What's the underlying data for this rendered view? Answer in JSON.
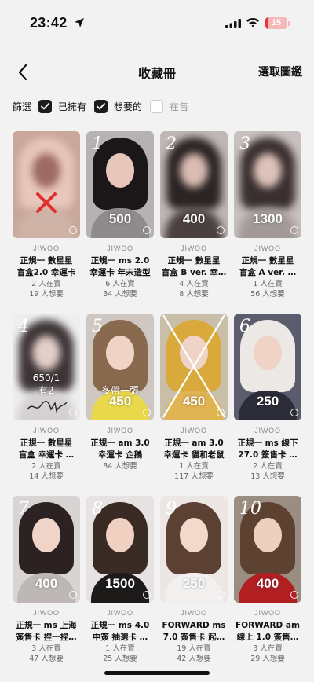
{
  "status": {
    "time": "23:42",
    "battery": "15",
    "battery_level": 0.15,
    "battery_color": "#e8353b"
  },
  "nav": {
    "title": "收藏冊",
    "right_action": "選取圖鑑"
  },
  "filters": {
    "label": "篩選",
    "items": [
      {
        "label": "已擁有",
        "checked": true
      },
      {
        "label": "想要的",
        "checked": true
      },
      {
        "label": "在售",
        "checked": false
      }
    ]
  },
  "cards": [
    {
      "brand": "JIWOO",
      "name1": "正規一 數星星",
      "name2": "盲盒2.0 幸運卡",
      "stat1": "2 人在賣",
      "stat2": "19 人想要",
      "price": "",
      "handwritten": "",
      "note1": "",
      "note2": "",
      "crossed": true,
      "blur": true,
      "colors": [
        "#c9a79a",
        "#e9c7bb",
        "#9c6a62",
        "#cfb3a7"
      ]
    },
    {
      "brand": "JIWOO",
      "name1": "正規一 ms 2.0",
      "name2": "幸運卡 年末造型",
      "stat1": "6 人在賣",
      "stat2": "34 人想要",
      "price": "500",
      "handwritten": "1",
      "note1": "",
      "note2": "",
      "crossed": false,
      "blur": false,
      "colors": [
        "#b6b1b2",
        "#1b1719",
        "#e7c7bb",
        "#8f8a8c"
      ]
    },
    {
      "brand": "JIWOO",
      "name1": "正規一 數星星",
      "name2": "盲盒 B ver. 幸…",
      "stat1": "4 人在賣",
      "stat2": "8 人想要",
      "price": "400",
      "handwritten": "2",
      "note1": "",
      "note2": "",
      "crossed": false,
      "blur": true,
      "colors": [
        "#bfb7b5",
        "#2b2424",
        "#d9bcb2",
        "#4a4040"
      ]
    },
    {
      "brand": "JIWOO",
      "name1": "正規一 數星星",
      "name2": "盲盒 A ver. …",
      "stat1": "1 人在賣",
      "stat2": "56 人想要",
      "price": "1300",
      "handwritten": "3",
      "note1": "",
      "note2": "",
      "crossed": false,
      "blur": true,
      "colors": [
        "#c8c0be",
        "#3a3030",
        "#dec3ba",
        "#a29997"
      ]
    },
    {
      "brand": "JIWOO",
      "name1": "正規一 數星星",
      "name2": "盲盒 幸運卡 …",
      "stat1": "2 人在賣",
      "stat2": "14 人想要",
      "price": "",
      "handwritten": "4",
      "note1": "650/1",
      "note2": "有2",
      "crossed": false,
      "blur": true,
      "colors": [
        "#eeeeee",
        "#3d3436",
        "#e2cfc9",
        "#d5d0d1"
      ]
    },
    {
      "brand": "JIWOO",
      "name1": "正規一 am 3.0",
      "name2": "幸運卡 企鵝",
      "stat1": "84 人想要",
      "stat2": "",
      "price": "450",
      "handwritten": "5",
      "note1": "",
      "note2": "多帶一張",
      "crossed": false,
      "blur": false,
      "colors": [
        "#cfc8c2",
        "#8a6a4e",
        "#efd3c6",
        "#e9d84a"
      ]
    },
    {
      "brand": "JIWOO",
      "name1": "正規一 am 3.0",
      "name2": "幸運卡 貓和老鼠",
      "stat1": "1 人在賣",
      "stat2": "117 人想要",
      "price": "450",
      "handwritten": "",
      "note1": "",
      "note2": "",
      "crossed": true,
      "blur": false,
      "colors": [
        "#c9bfa9",
        "#d9a93b",
        "#efd3c6",
        "#e1b452"
      ]
    },
    {
      "brand": "JIWOO",
      "name1": "正規一 ms 線下",
      "name2": "27.0 簽售卡 …",
      "stat1": "2 人在賣",
      "stat2": "13 人想要",
      "price": "250",
      "handwritten": "6",
      "note1": "",
      "note2": "",
      "crossed": false,
      "blur": false,
      "colors": [
        "#5b5d6e",
        "#ece8e6",
        "#efd3c6",
        "#2b2c38"
      ]
    },
    {
      "brand": "JIWOO",
      "name1": "正規一 ms 上海",
      "name2": "簽售卡 捏一捏…",
      "stat1": "3 人在賣",
      "stat2": "47 人想要",
      "price": "400",
      "handwritten": "7",
      "note1": "",
      "note2": "",
      "crossed": false,
      "blur": false,
      "colors": [
        "#d8d4d3",
        "#2c2223",
        "#f0d4c8",
        "#bdb7b6"
      ]
    },
    {
      "brand": "JIWOO",
      "name1": "正規一 ms 4.0",
      "name2": "中簽 抽選卡 …",
      "stat1": "1 人在賣",
      "stat2": "25 人想要",
      "price": "1500",
      "handwritten": "8",
      "note1": "",
      "note2": "",
      "crossed": false,
      "blur": false,
      "colors": [
        "#e6e2e1",
        "#3a2a24",
        "#efd0c1",
        "#1d1a1a"
      ]
    },
    {
      "brand": "JIWOO",
      "name1": "FORWARD ms",
      "name2": "7.0 簽售卡 起…",
      "stat1": "19 人在賣",
      "stat2": "42 人想要",
      "price": "250",
      "handwritten": "9",
      "note1": "",
      "note2": "",
      "crossed": false,
      "blur": false,
      "colors": [
        "#ece7e4",
        "#5c4034",
        "#f3d8cc",
        "#f1f0ef"
      ]
    },
    {
      "brand": "JIWOO",
      "name1": "FORWARD am",
      "name2": "線上 1.0 簽售…",
      "stat1": "3 人在賣",
      "stat2": "29 人想要",
      "price": "400",
      "handwritten": "10",
      "note1": "",
      "note2": "",
      "crossed": false,
      "blur": false,
      "colors": [
        "#9a8d82",
        "#5e4231",
        "#eed0c0",
        "#b11f23"
      ]
    }
  ]
}
